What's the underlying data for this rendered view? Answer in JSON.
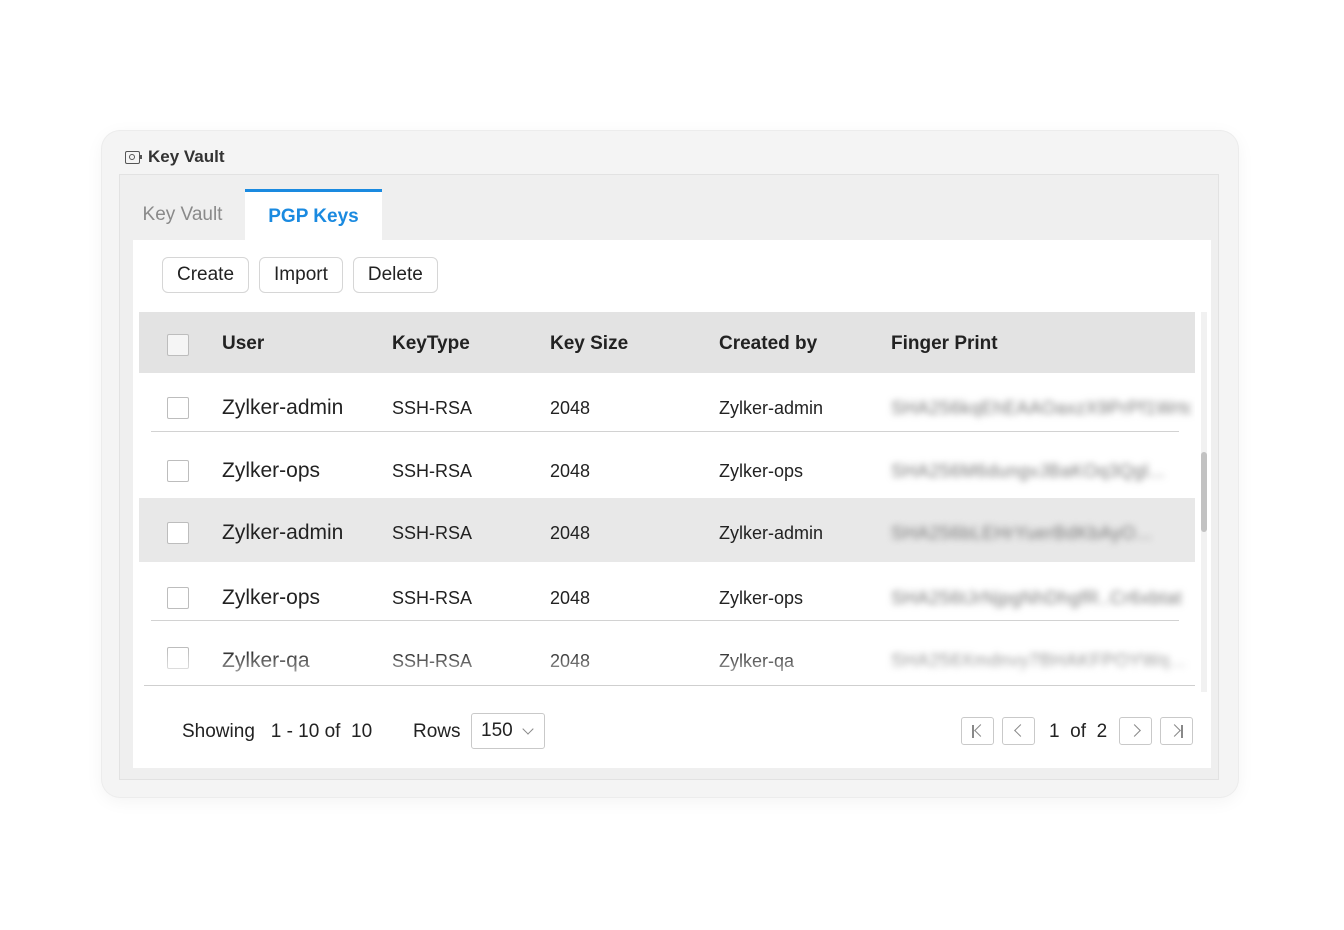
{
  "window": {
    "title": "Key Vault"
  },
  "tabs": [
    {
      "label": "Key Vault",
      "active": false
    },
    {
      "label": "PGP Keys",
      "active": true
    }
  ],
  "toolbar": {
    "create_label": "Create",
    "import_label": "Import",
    "delete_label": "Delete"
  },
  "table": {
    "columns": {
      "user": "User",
      "key_type": "KeyType",
      "key_size": "Key Size",
      "created_by": "Created by",
      "finger_print": "Finger Print"
    },
    "rows": [
      {
        "user": "Zylker-admin",
        "key_type": "SSH-RSA",
        "key_size": "2048",
        "created_by": "Zylker-admin",
        "finger_print": "SHA256kqEhEAAOaxzX9PrPf1Wrtq"
      },
      {
        "user": "Zylker-ops",
        "key_type": "SSH-RSA",
        "key_size": "2048",
        "created_by": "Zylker-ops",
        "finger_print": "SHA256M6dungvJBaKOq3Qgl..."
      },
      {
        "user": "Zylker-admin",
        "key_type": "SSH-RSA",
        "key_size": "2048",
        "created_by": "Zylker-admin",
        "finger_print": "SHA256bLEHrYuerBdKbAyO..."
      },
      {
        "user": "Zylker-ops",
        "key_type": "SSH-RSA",
        "key_size": "2048",
        "created_by": "Zylker-ops",
        "finger_print": "SHA256tJrNjpgNhDhgfR..Cr6xbtat"
      },
      {
        "user": "Zylker-qa",
        "key_type": "SSH-RSA",
        "key_size": "2048",
        "created_by": "Zylker-qa",
        "finger_print": "SHA256Xmdnvy7BHAKFPOYWq..."
      }
    ],
    "highlighted_row_index": 2
  },
  "footer": {
    "showing_label": "Showing",
    "showing_range": "1 - 10 of  10",
    "rows_label": "Rows",
    "rows_value": "150",
    "page_current": "1",
    "page_of": "of",
    "page_total": "2"
  },
  "colors": {
    "accent": "#1a8ae0",
    "header_bg": "#e3e3e3",
    "highlight_row": "#e8e8e8"
  },
  "icons": [
    "vault-icon",
    "checkbox",
    "chevron-down-icon",
    "first-page-icon",
    "prev-page-icon",
    "next-page-icon",
    "last-page-icon"
  ]
}
